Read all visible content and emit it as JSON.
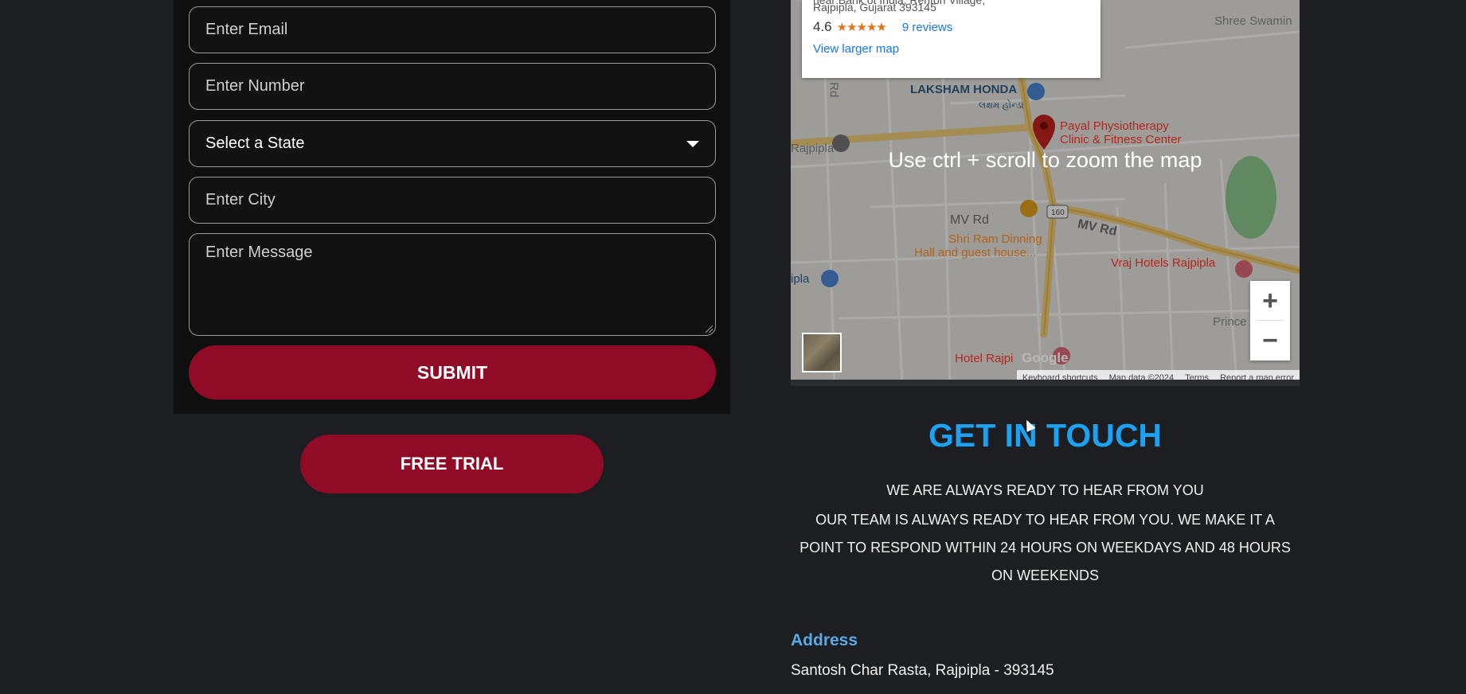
{
  "form": {
    "email_placeholder": "Enter Email",
    "number_placeholder": "Enter Number",
    "state_selected": "Select a State",
    "city_placeholder": "Enter City",
    "message_placeholder": "Enter Message",
    "submit_label": "SUBMIT"
  },
  "free_trial_label": "FREE TRIAL",
  "map": {
    "info_card": {
      "address_line1": "near Bank of India, Renton Village,",
      "address_line2": "Rajpipla, Gujarat 393145",
      "rating": "4.6",
      "stars": "★★★★★",
      "reviews": "9 reviews",
      "larger_map": "View larger map"
    },
    "zoom_hint": "Use ctrl + scroll to zoom the map",
    "labels": {
      "shree_swami": "Shree Swamin",
      "laksham_honda": "LAKSHAM HONDA",
      "laksham_honda_local": "લક્ષમ હોન્ડા",
      "payal_line1": "Payal Physiotherapy",
      "payal_line2": "Clinic & Fitness Center",
      "rajpipla_left": "Rajpipla",
      "mv_rd_1": "MV Rd",
      "mv_rd_2": "MV Rd",
      "shri_ram_line1": "Shri Ram Dinning",
      "shri_ram_line2": "Hall and guest house...",
      "vraj_hotels": "Vraj Hotels Rajpipla",
      "prince": "Prince",
      "hotel_rajpi": "Hotel Rajpi",
      "highway": "160",
      "rn_rd": "n Rd",
      "pipla": "ipla"
    },
    "attribution": {
      "shortcuts": "Keyboard shortcuts",
      "map_data": "Map data ©2024",
      "terms": "Terms",
      "report": "Report a map error"
    },
    "logo": "Google"
  },
  "touch": {
    "title": "GET IN TOUCH",
    "lead": "WE ARE ALWAYS READY TO HEAR FROM YOU",
    "body_line1": "OUR TEAM IS ALWAYS READY TO HEAR FROM YOU. WE MAKE IT A",
    "body_line2": "POINT TO RESPOND WITHIN 24 HOURS ON WEEKDAYS AND 48 HOURS",
    "body_line3": "ON WEEKENDS",
    "address_label": "Address",
    "address_value": "Santosh Char Rasta, Rajpipla - 393145"
  },
  "colors": {
    "page_bg": "#1c1e21",
    "panel_bg": "#0f0f10",
    "accent_red": "#8f0b26",
    "title_blue": "#1da1f2",
    "address_blue": "#5aa9e6"
  }
}
